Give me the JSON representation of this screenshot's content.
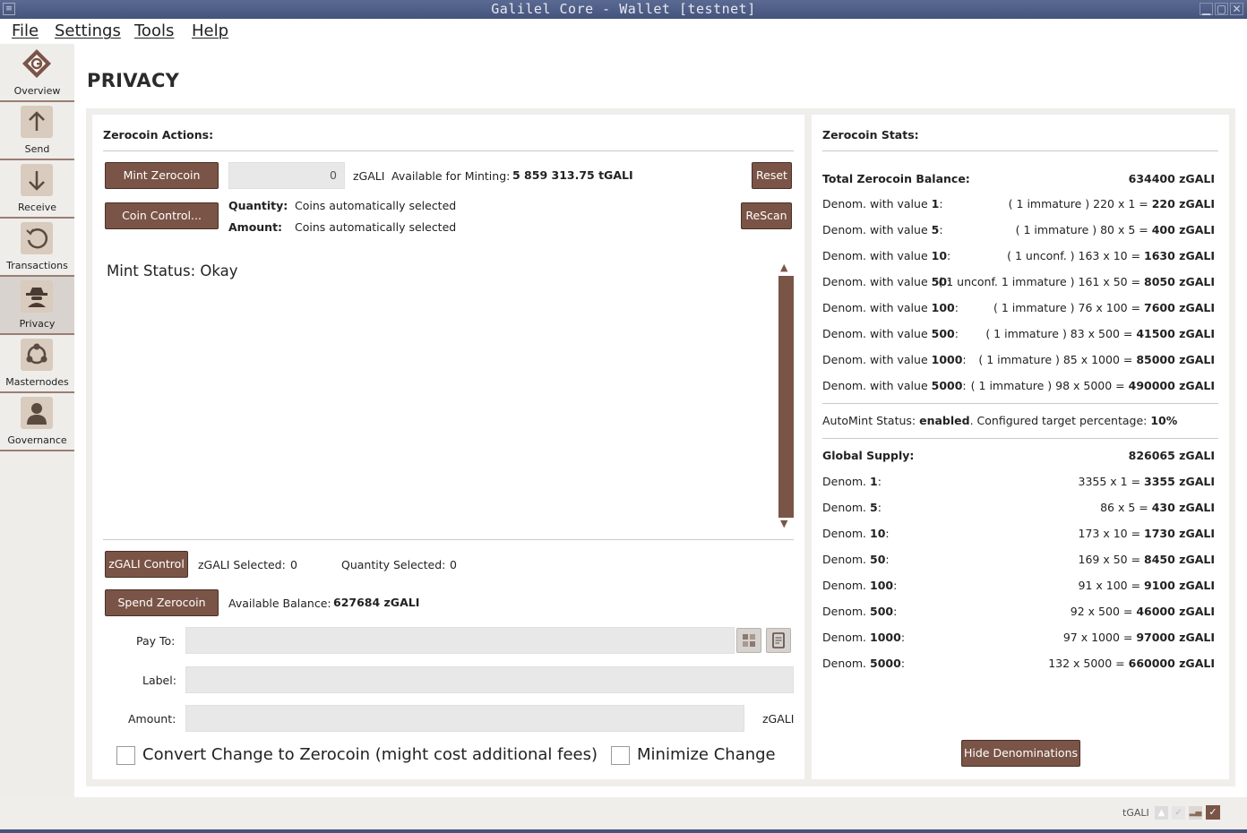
{
  "window": {
    "title": "Galilel Core - Wallet [testnet]"
  },
  "menu": [
    "File",
    "Settings",
    "Tools",
    "Help"
  ],
  "sidebar": {
    "items": [
      {
        "label": "Overview",
        "icon": "galilel-logo-icon"
      },
      {
        "label": "Send",
        "icon": "arrow-up-icon"
      },
      {
        "label": "Receive",
        "icon": "arrow-down-icon"
      },
      {
        "label": "Transactions",
        "icon": "history-icon"
      },
      {
        "label": "Privacy",
        "icon": "spy-icon",
        "active": true
      },
      {
        "label": "Masternodes",
        "icon": "network-icon"
      },
      {
        "label": "Governance",
        "icon": "user-icon"
      }
    ]
  },
  "page": {
    "title": "PRIVACY"
  },
  "actions": {
    "header": "Zerocoin Actions:",
    "mint_button": "Mint Zerocoin",
    "mint_amount": "0",
    "mint_unit": "zGALI",
    "available_label": "Available for Minting:",
    "available_value": "5 859 313.75 tGALI",
    "reset_button": "Reset",
    "coin_control_button": "Coin Control...",
    "quantity_label": "Quantity:",
    "quantity_value": "Coins automatically selected",
    "amount_label": "Amount:",
    "amount_value": "Coins automatically selected",
    "rescan_button": "ReScan",
    "mint_status": "Mint Status: Okay",
    "zgali_control_button": "zGALI Control",
    "zgali_selected_label": "zGALI Selected:",
    "zgali_selected_value": "0",
    "quantity_selected_label": "Quantity Selected:",
    "quantity_selected_value": "0",
    "spend_button": "Spend Zerocoin",
    "balance_label": "Available Balance:",
    "balance_value": "627684 zGALI",
    "payto_label": "Pay To:",
    "label_label": "Label:",
    "amount_field_label": "Amount:",
    "amount_unit": "zGALI",
    "convert_change": "Convert Change to Zerocoin (might cost additional fees)",
    "minimize_change": "Minimize Change"
  },
  "stats": {
    "header": "Zerocoin Stats:",
    "total_label": "Total Zerocoin Balance:",
    "total_value": "634400 zGALI",
    "denoms": [
      {
        "label": "Denom. with value ",
        "value": "1",
        "detail": "( 1 immature ) 220 x 1 = ",
        "total": "220 zGALI"
      },
      {
        "label": "Denom. with value ",
        "value": "5",
        "detail": "( 1 immature ) 80 x 5 = ",
        "total": "400 zGALI"
      },
      {
        "label": "Denom. with value ",
        "value": "10",
        "detail": "( 1 unconf. ) 163 x 10 = ",
        "total": "1630 zGALI"
      },
      {
        "label": "Denom. with value ",
        "value": "50",
        "detail": "( 1 unconf. 1 immature ) 161 x 50 = ",
        "total": "8050 zGALI"
      },
      {
        "label": "Denom. with value ",
        "value": "100",
        "detail": "( 1 immature ) 76 x 100 = ",
        "total": "7600 zGALI"
      },
      {
        "label": "Denom. with value ",
        "value": "500",
        "detail": "( 1 immature ) 83 x 500 = ",
        "total": "41500 zGALI"
      },
      {
        "label": "Denom. with value ",
        "value": "1000",
        "detail": "( 1 immature ) 85 x 1000 = ",
        "total": "85000 zGALI"
      },
      {
        "label": "Denom. with value ",
        "value": "5000",
        "detail": "( 1 immature ) 98 x 5000 = ",
        "total": "490000 zGALI"
      }
    ],
    "automint_label": "AutoMint Status: ",
    "automint_value": "enabled",
    "automint_mid": ". Configured target percentage: ",
    "automint_pct": "10%",
    "supply_label": "Global Supply:",
    "supply_value": "826065 zGALI",
    "supply": [
      {
        "label": "Denom. ",
        "value": "1",
        "detail": "3355 x 1 = ",
        "total": "3355 zGALI"
      },
      {
        "label": "Denom. ",
        "value": "5",
        "detail": "86 x 5 = ",
        "total": "430 zGALI"
      },
      {
        "label": "Denom. ",
        "value": "10",
        "detail": "173 x 10 = ",
        "total": "1730 zGALI"
      },
      {
        "label": "Denom. ",
        "value": "50",
        "detail": "169 x 50 = ",
        "total": "8450 zGALI"
      },
      {
        "label": "Denom. ",
        "value": "100",
        "detail": "91 x 100 = ",
        "total": "9100 zGALI"
      },
      {
        "label": "Denom. ",
        "value": "500",
        "detail": "92 x 500 = ",
        "total": "46000 zGALI"
      },
      {
        "label": "Denom. ",
        "value": "1000",
        "detail": "97 x 1000 = ",
        "total": "97000 zGALI"
      },
      {
        "label": "Denom. ",
        "value": "5000",
        "detail": "132 x 5000 = ",
        "total": "660000 zGALI"
      }
    ],
    "hide_button": "Hide Denominations"
  },
  "statusbar": {
    "unit": "tGALI"
  },
  "colors": {
    "accent": "#7a5446",
    "title_bar": "#4f5e87"
  }
}
